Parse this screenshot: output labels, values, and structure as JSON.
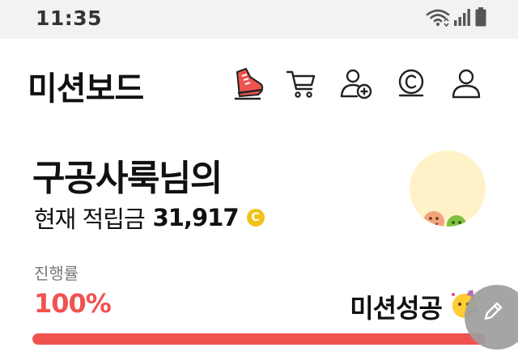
{
  "status_bar": {
    "time": "11:35",
    "icons": [
      "wifi-icon",
      "signal-icon",
      "battery-icon"
    ]
  },
  "header": {
    "title": "미션보드",
    "icons": [
      "sneaker-icon",
      "cart-icon",
      "user-add-icon",
      "coin-icon",
      "profile-icon"
    ],
    "accent_color": "#ef5350"
  },
  "profile": {
    "greeting": "구공사룩님의",
    "balance_label": "현재 적립금",
    "balance_value": "31,917",
    "coin_symbol": "C",
    "coin_color": "#f2c21b",
    "avatar_bg": "#fff2c8"
  },
  "progress": {
    "label": "진행률",
    "value_text": "100%",
    "fraction": 1.0,
    "status_text": "미션성공",
    "status_icon": "party-face-icon",
    "color": "#ef5350"
  },
  "fab": {
    "icon": "pencil-icon"
  }
}
